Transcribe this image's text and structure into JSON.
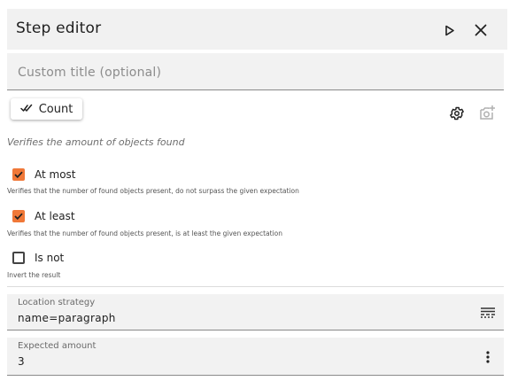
{
  "header": {
    "title": "Step editor"
  },
  "custom_title": {
    "placeholder": "Custom title (optional)",
    "value": ""
  },
  "step": {
    "type_label": "Count",
    "description": "Verifies the amount of objects found"
  },
  "options": [
    {
      "label": "At most",
      "checked": true,
      "hint": "Verifies that the number of found objects present, do not surpass the given expectation"
    },
    {
      "label": "At least",
      "checked": true,
      "hint": "Verifies that the number of found objects present, is at least the given expectation"
    },
    {
      "label": "Is not",
      "checked": false,
      "hint": "Invert the result"
    }
  ],
  "location": {
    "label": "Location strategy",
    "value": "name=paragraph"
  },
  "expected": {
    "label": "Expected amount",
    "value": "3"
  },
  "colors": {
    "accent": "#f07838",
    "field_bg": "#f2f2f2"
  },
  "icons": [
    "play-icon",
    "close-icon",
    "count-check-icon",
    "gear-icon",
    "add-photo-icon",
    "locator-icon",
    "more-vert-icon"
  ]
}
